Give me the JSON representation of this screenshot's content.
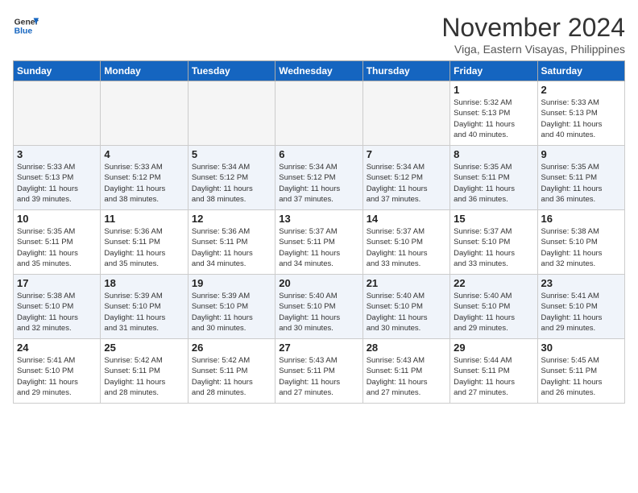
{
  "header": {
    "logo_line1": "General",
    "logo_line2": "Blue",
    "month": "November 2024",
    "location": "Viga, Eastern Visayas, Philippines"
  },
  "days_of_week": [
    "Sunday",
    "Monday",
    "Tuesday",
    "Wednesday",
    "Thursday",
    "Friday",
    "Saturday"
  ],
  "weeks": [
    [
      {
        "day": "",
        "info": ""
      },
      {
        "day": "",
        "info": ""
      },
      {
        "day": "",
        "info": ""
      },
      {
        "day": "",
        "info": ""
      },
      {
        "day": "",
        "info": ""
      },
      {
        "day": "1",
        "info": "Sunrise: 5:32 AM\nSunset: 5:13 PM\nDaylight: 11 hours\nand 40 minutes."
      },
      {
        "day": "2",
        "info": "Sunrise: 5:33 AM\nSunset: 5:13 PM\nDaylight: 11 hours\nand 40 minutes."
      }
    ],
    [
      {
        "day": "3",
        "info": "Sunrise: 5:33 AM\nSunset: 5:13 PM\nDaylight: 11 hours\nand 39 minutes."
      },
      {
        "day": "4",
        "info": "Sunrise: 5:33 AM\nSunset: 5:12 PM\nDaylight: 11 hours\nand 38 minutes."
      },
      {
        "day": "5",
        "info": "Sunrise: 5:34 AM\nSunset: 5:12 PM\nDaylight: 11 hours\nand 38 minutes."
      },
      {
        "day": "6",
        "info": "Sunrise: 5:34 AM\nSunset: 5:12 PM\nDaylight: 11 hours\nand 37 minutes."
      },
      {
        "day": "7",
        "info": "Sunrise: 5:34 AM\nSunset: 5:12 PM\nDaylight: 11 hours\nand 37 minutes."
      },
      {
        "day": "8",
        "info": "Sunrise: 5:35 AM\nSunset: 5:11 PM\nDaylight: 11 hours\nand 36 minutes."
      },
      {
        "day": "9",
        "info": "Sunrise: 5:35 AM\nSunset: 5:11 PM\nDaylight: 11 hours\nand 36 minutes."
      }
    ],
    [
      {
        "day": "10",
        "info": "Sunrise: 5:35 AM\nSunset: 5:11 PM\nDaylight: 11 hours\nand 35 minutes."
      },
      {
        "day": "11",
        "info": "Sunrise: 5:36 AM\nSunset: 5:11 PM\nDaylight: 11 hours\nand 35 minutes."
      },
      {
        "day": "12",
        "info": "Sunrise: 5:36 AM\nSunset: 5:11 PM\nDaylight: 11 hours\nand 34 minutes."
      },
      {
        "day": "13",
        "info": "Sunrise: 5:37 AM\nSunset: 5:11 PM\nDaylight: 11 hours\nand 34 minutes."
      },
      {
        "day": "14",
        "info": "Sunrise: 5:37 AM\nSunset: 5:10 PM\nDaylight: 11 hours\nand 33 minutes."
      },
      {
        "day": "15",
        "info": "Sunrise: 5:37 AM\nSunset: 5:10 PM\nDaylight: 11 hours\nand 33 minutes."
      },
      {
        "day": "16",
        "info": "Sunrise: 5:38 AM\nSunset: 5:10 PM\nDaylight: 11 hours\nand 32 minutes."
      }
    ],
    [
      {
        "day": "17",
        "info": "Sunrise: 5:38 AM\nSunset: 5:10 PM\nDaylight: 11 hours\nand 32 minutes."
      },
      {
        "day": "18",
        "info": "Sunrise: 5:39 AM\nSunset: 5:10 PM\nDaylight: 11 hours\nand 31 minutes."
      },
      {
        "day": "19",
        "info": "Sunrise: 5:39 AM\nSunset: 5:10 PM\nDaylight: 11 hours\nand 30 minutes."
      },
      {
        "day": "20",
        "info": "Sunrise: 5:40 AM\nSunset: 5:10 PM\nDaylight: 11 hours\nand 30 minutes."
      },
      {
        "day": "21",
        "info": "Sunrise: 5:40 AM\nSunset: 5:10 PM\nDaylight: 11 hours\nand 30 minutes."
      },
      {
        "day": "22",
        "info": "Sunrise: 5:40 AM\nSunset: 5:10 PM\nDaylight: 11 hours\nand 29 minutes."
      },
      {
        "day": "23",
        "info": "Sunrise: 5:41 AM\nSunset: 5:10 PM\nDaylight: 11 hours\nand 29 minutes."
      }
    ],
    [
      {
        "day": "24",
        "info": "Sunrise: 5:41 AM\nSunset: 5:10 PM\nDaylight: 11 hours\nand 29 minutes."
      },
      {
        "day": "25",
        "info": "Sunrise: 5:42 AM\nSunset: 5:11 PM\nDaylight: 11 hours\nand 28 minutes."
      },
      {
        "day": "26",
        "info": "Sunrise: 5:42 AM\nSunset: 5:11 PM\nDaylight: 11 hours\nand 28 minutes."
      },
      {
        "day": "27",
        "info": "Sunrise: 5:43 AM\nSunset: 5:11 PM\nDaylight: 11 hours\nand 27 minutes."
      },
      {
        "day": "28",
        "info": "Sunrise: 5:43 AM\nSunset: 5:11 PM\nDaylight: 11 hours\nand 27 minutes."
      },
      {
        "day": "29",
        "info": "Sunrise: 5:44 AM\nSunset: 5:11 PM\nDaylight: 11 hours\nand 27 minutes."
      },
      {
        "day": "30",
        "info": "Sunrise: 5:45 AM\nSunset: 5:11 PM\nDaylight: 11 hours\nand 26 minutes."
      }
    ]
  ]
}
